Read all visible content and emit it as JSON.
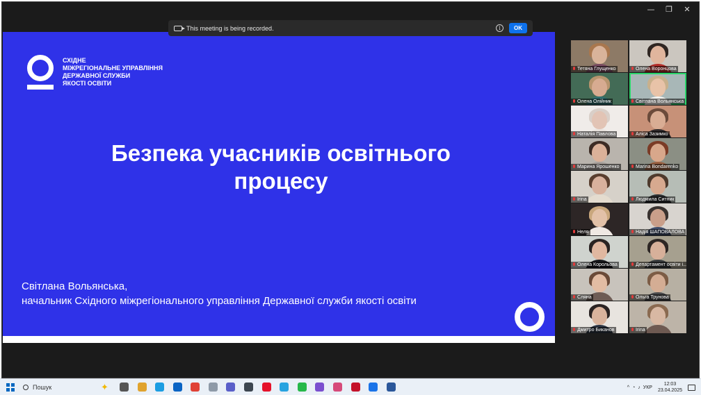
{
  "window": {
    "minimize": "—",
    "restore": "❐",
    "close": "✕"
  },
  "recording_banner": {
    "message": "This meeting is being recorded.",
    "info": "i",
    "ok": "OK"
  },
  "slide": {
    "org_lines": [
      "СХІДНЕ",
      "МІЖРЕГІОНАЛЬНЕ УПРАВЛІННЯ",
      "ДЕРЖАВНОЇ СЛУЖБИ",
      "ЯКОСТІ ОСВІТИ"
    ],
    "title_line1": "Безпека учасників освітнього",
    "title_line2": "процесу",
    "speaker_name": "Світлана Вольянська,",
    "speaker_role": "начальник Східного міжрегіонального управління Державної служби якості освіти"
  },
  "participants": [
    {
      "name": "Тетяна Глущенко",
      "skin": "#d9b39a",
      "hair": "#a9774e",
      "bg": "#8d7a66",
      "shirt": "#7a4b61"
    },
    {
      "name": "Олена Воронцова",
      "skin": "#e0b59d",
      "hair": "#2f2622",
      "bg": "#cbc6bf",
      "shirt": "#b62f2b"
    },
    {
      "name": "Олена Олійник",
      "skin": "#d7ab91",
      "hair": "#b7946e",
      "bg": "#436b56",
      "shirt": "#2f6f70"
    },
    {
      "name": "Світлана Вольянська",
      "skin": "#e8c3a8",
      "hair": "#c8b08c",
      "bg": "#a8b7b7",
      "shirt": "#f1f1ee"
    },
    {
      "name": "Наталія Павлова",
      "skin": "#e2c4b5",
      "hair": "#d9cfc8",
      "bg": "#f0ece9",
      "shirt": "#e8e1dc"
    },
    {
      "name": "Аліса Зазимко",
      "skin": "#d9ad94",
      "hair": "#6b4b3b",
      "bg": "#c79178",
      "shirt": "#2f2a2b"
    },
    {
      "name": "Марина Ярошенко",
      "skin": "#dbb199",
      "hair": "#3d2c25",
      "bg": "#b9b4ad",
      "shirt": "#a8a09b"
    },
    {
      "name": "Marina Bondarenko",
      "skin": "#d8a78b",
      "hair": "#7b3b26",
      "bg": "#8b8f84",
      "shirt": "#9c6242"
    },
    {
      "name": "Irina",
      "skin": "#d8b19d",
      "hair": "#5a3f2f",
      "bg": "#d6d1c9",
      "shirt": "#e4dccf"
    },
    {
      "name": "Людмила Ситник",
      "skin": "#d7a98f",
      "hair": "#4e3a2d",
      "bg": "#b6bdb6",
      "shirt": "#2b2d2f"
    },
    {
      "name": "Неля",
      "skin": "#e2c1a8",
      "hair": "#c9a77d",
      "bg": "#2d2626",
      "shirt": "#efe8e3"
    },
    {
      "name": "Надія ШАПОВАЛОВА",
      "skin": "#c99f8a",
      "hair": "#39322f",
      "bg": "#d8d4cf",
      "shirt": "#3f4d6a"
    },
    {
      "name": "Олена Корольова",
      "skin": "#e0b7a0",
      "hair": "#2a2322",
      "bg": "#cfd3ce",
      "shirt": "#191a1d"
    },
    {
      "name": "Департамент освіти і...",
      "skin": "#d7b09a",
      "hair": "#2d2624",
      "bg": "#a6a08f",
      "shirt": "#3a3d3f"
    },
    {
      "name": "Сляна",
      "skin": "#e2bca3",
      "hair": "#6a4a38",
      "bg": "#c8c3bc",
      "shirt": "#6e5c55"
    },
    {
      "name": "Ольга Трунова",
      "skin": "#d4ad94",
      "hair": "#7c5c45",
      "bg": "#b7b0a3",
      "shirt": "#4a4a4c"
    },
    {
      "name": "Дмитро Биканов",
      "skin": "#d9b39c",
      "hair": "#2a2322",
      "bg": "#e8e4df",
      "shirt": "#2c3442"
    },
    {
      "name": "Irina",
      "skin": "#d8b8a3",
      "hair": "#8a6a50",
      "bg": "#bdb4a8",
      "shirt": "#6e5a52"
    }
  ],
  "taskbar": {
    "search": "Пошук",
    "apps": [
      {
        "icon": "task-view-icon",
        "color": "#555555"
      },
      {
        "icon": "copilot-icon",
        "color": "#e0a32e"
      },
      {
        "icon": "edge-icon",
        "color": "#1b9de2"
      },
      {
        "icon": "outlook-icon",
        "color": "#0a64c4"
      },
      {
        "icon": "chrome-icon",
        "color": "#e04135"
      },
      {
        "icon": "paint-icon",
        "color": "#8e9aa8"
      },
      {
        "icon": "teams-icon",
        "color": "#5a5fc9"
      },
      {
        "icon": "calculator-icon",
        "color": "#3d4650"
      },
      {
        "icon": "opera-icon",
        "color": "#e5122a"
      },
      {
        "icon": "telegram-icon",
        "color": "#27a3e0"
      },
      {
        "icon": "whatsapp-icon",
        "color": "#27b84a"
      },
      {
        "icon": "viber-icon",
        "color": "#7b4fcf"
      },
      {
        "icon": "store-icon",
        "color": "#d64a7a"
      },
      {
        "icon": "pdf-reader-icon",
        "color": "#c4122a"
      },
      {
        "icon": "zoom-icon",
        "color": "#1a73e8"
      },
      {
        "icon": "word-icon",
        "color": "#2b579a"
      }
    ],
    "tray_chevron": "^",
    "language": "УКР",
    "time": "12:03",
    "date": "23.04.2025"
  }
}
